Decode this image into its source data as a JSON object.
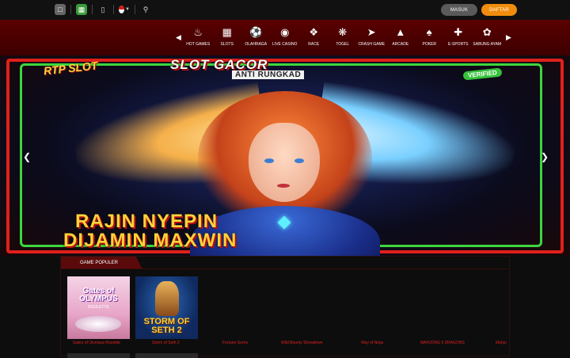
{
  "topbar": {
    "icons": [
      "chat-icon",
      "android-icon",
      "mobile-icon",
      "search-icon"
    ],
    "login_label": "MASUK",
    "register_label": "DAFTAR"
  },
  "categories": [
    {
      "label": "HOT GAMES",
      "icon": "fire-bowl-icon"
    },
    {
      "label": "SLOTS",
      "icon": "slot-machine-icon"
    },
    {
      "label": "OLAHRAGA",
      "icon": "soccer-ball-icon"
    },
    {
      "label": "LIVE CASINO",
      "icon": "casino-chip-icon"
    },
    {
      "label": "RACE",
      "icon": "race-icon"
    },
    {
      "label": "TOGEL",
      "icon": "lottery-ball-icon"
    },
    {
      "label": "CRASH GAME",
      "icon": "rocket-icon"
    },
    {
      "label": "ARCADE",
      "icon": "arcade-icon"
    },
    {
      "label": "POKER",
      "icon": "poker-icon"
    },
    {
      "label": "E-SPORTS",
      "icon": "gamepad-icon"
    },
    {
      "label": "SABUNG AYAM",
      "icon": "rooster-icon"
    }
  ],
  "banner": {
    "title": "SLOT GACOR",
    "subtitle": "ANTI RUNGKAD",
    "rtp": "RTP SLOT",
    "verified": "VERIFIED",
    "line1": "RAJIN NYEPIN",
    "line2": "DIJAMIN MAXWIN"
  },
  "popular": {
    "heading": "GAME POPULER",
    "games": [
      {
        "name": "Gates of Olympus Roulette",
        "thumb_title": "Gates of OLYMPUS",
        "thumb_sub": "ROULETTE"
      },
      {
        "name": "Storm of Seth 2",
        "thumb_title": "STORM OF SETH 2"
      },
      {
        "name": "Fortune Gems"
      },
      {
        "name": "Wild Bounty Showdown"
      },
      {
        "name": "Way of Ninja"
      },
      {
        "name": "MAHJONG 5 DRAGONS"
      },
      {
        "name": "Mahjo"
      }
    ]
  }
}
